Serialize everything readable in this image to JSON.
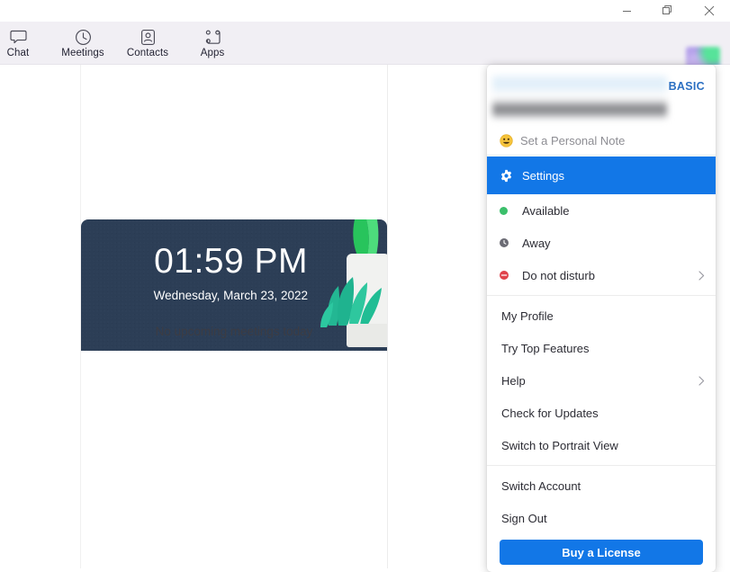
{
  "window": {
    "controls": [
      {
        "name": "minimize",
        "glyph": "minimize-icon"
      },
      {
        "name": "maximize",
        "glyph": "restore-icon"
      },
      {
        "name": "close",
        "glyph": "close-icon"
      }
    ]
  },
  "toolbar": {
    "items": [
      {
        "label": "Chat",
        "icon": "chat-bubble-icon"
      },
      {
        "label": "Meetings",
        "icon": "clock-icon"
      },
      {
        "label": "Contacts",
        "icon": "contact-card-icon"
      },
      {
        "label": "Apps",
        "icon": "apps-icon"
      }
    ],
    "avatar": {
      "icon": "user-avatar-blurred",
      "redacted": true
    }
  },
  "main": {
    "clock": {
      "time": "01:59 PM",
      "date": "Wednesday, March 23, 2022",
      "background_color": "#2c3e56",
      "illustration": "potted-plant-illustration"
    },
    "empty_state": "No upcoming meetings today"
  },
  "profile_menu": {
    "header": {
      "name_redacted": true,
      "plan_badge": "BASIC",
      "plan_badge_color": "#2b6fc2"
    },
    "personal_note": {
      "label": "Set a Personal Note",
      "emoji": "smiley-face-emoji"
    },
    "selected": {
      "label": "Settings",
      "icon": "gear-icon",
      "highlight_color": "#1277e7"
    },
    "status_items": [
      {
        "label": "Available",
        "icon": "status-available-icon",
        "color": "#3bbf6b",
        "chevron": false
      },
      {
        "label": "Away",
        "icon": "status-away-icon",
        "color": "#6b6b74",
        "chevron": false
      },
      {
        "label": "Do not disturb",
        "icon": "status-dnd-icon",
        "color": "#e0434b",
        "chevron": true
      }
    ],
    "actions": [
      {
        "label": "My Profile",
        "chevron": false
      },
      {
        "label": "Try Top Features",
        "chevron": false
      },
      {
        "label": "Help",
        "chevron": true
      },
      {
        "label": "Check for Updates",
        "chevron": false
      },
      {
        "label": "Switch to Portrait View",
        "chevron": false
      }
    ],
    "account_actions": [
      {
        "label": "Switch Account",
        "chevron": false
      },
      {
        "label": "Sign Out",
        "chevron": false
      }
    ],
    "buy_button": {
      "label": "Buy a License",
      "color": "#1277e7"
    }
  }
}
